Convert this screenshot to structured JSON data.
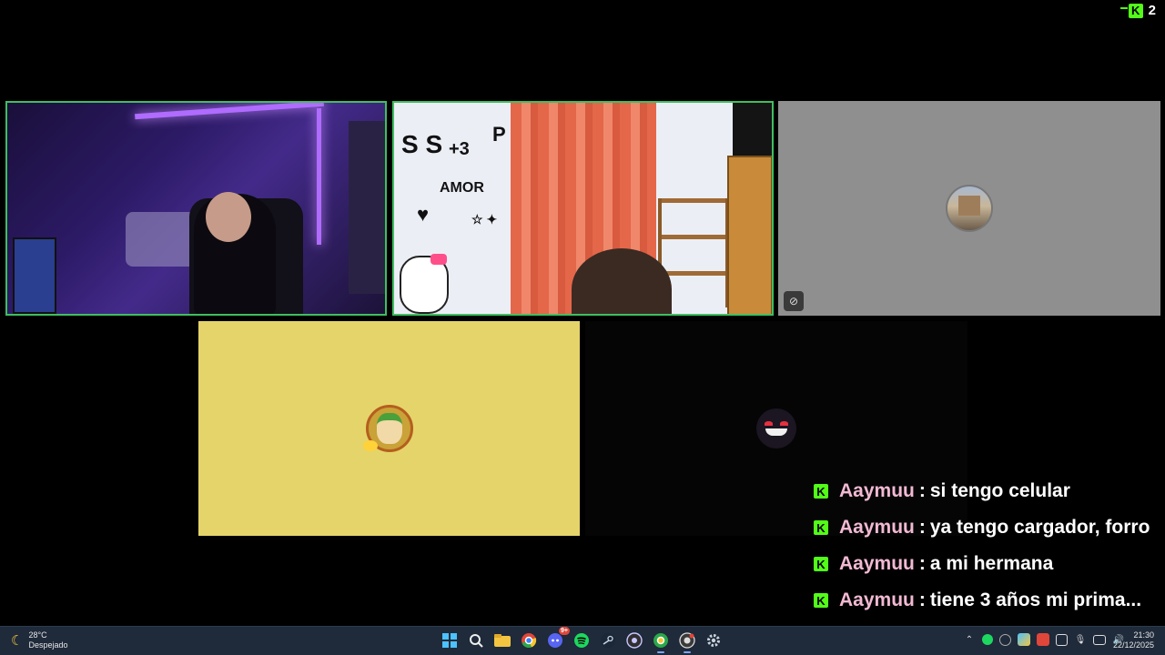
{
  "top_right": {
    "viewer_count": "2"
  },
  "tiles": [
    {
      "id": "t1",
      "kind": "camera",
      "speaking": true
    },
    {
      "id": "t2",
      "kind": "camera",
      "speaking": true
    },
    {
      "id": "t3",
      "kind": "avatar",
      "camera_off": true
    },
    {
      "id": "t4",
      "kind": "avatar"
    },
    {
      "id": "t5",
      "kind": "avatar"
    }
  ],
  "chat": [
    {
      "user": "Aaymuu",
      "text": "si tengo celular"
    },
    {
      "user": "Aaymuu",
      "text": "ya tengo cargador, forro"
    },
    {
      "user": "Aaymuu",
      "text": "a mi hermana"
    },
    {
      "user": "Aaymuu",
      "text": "tiene 3 años mi prima..."
    }
  ],
  "taskbar": {
    "weather": {
      "temp": "28°C",
      "condition": "Despejado"
    },
    "apps": [
      "windows-start",
      "search",
      "file-explorer",
      "chrome",
      "discord",
      "spotify",
      "steam",
      "obs",
      "chrome-profile",
      "chrome-profile-2",
      "settings"
    ],
    "discord_badge": "9+",
    "clock": {
      "time": "21:30",
      "date": "22/12/2025"
    }
  },
  "colors": {
    "kick_green": "#53fc18",
    "username_pink": "#f2b9d3",
    "speaking_border": "#3fbf5f"
  }
}
